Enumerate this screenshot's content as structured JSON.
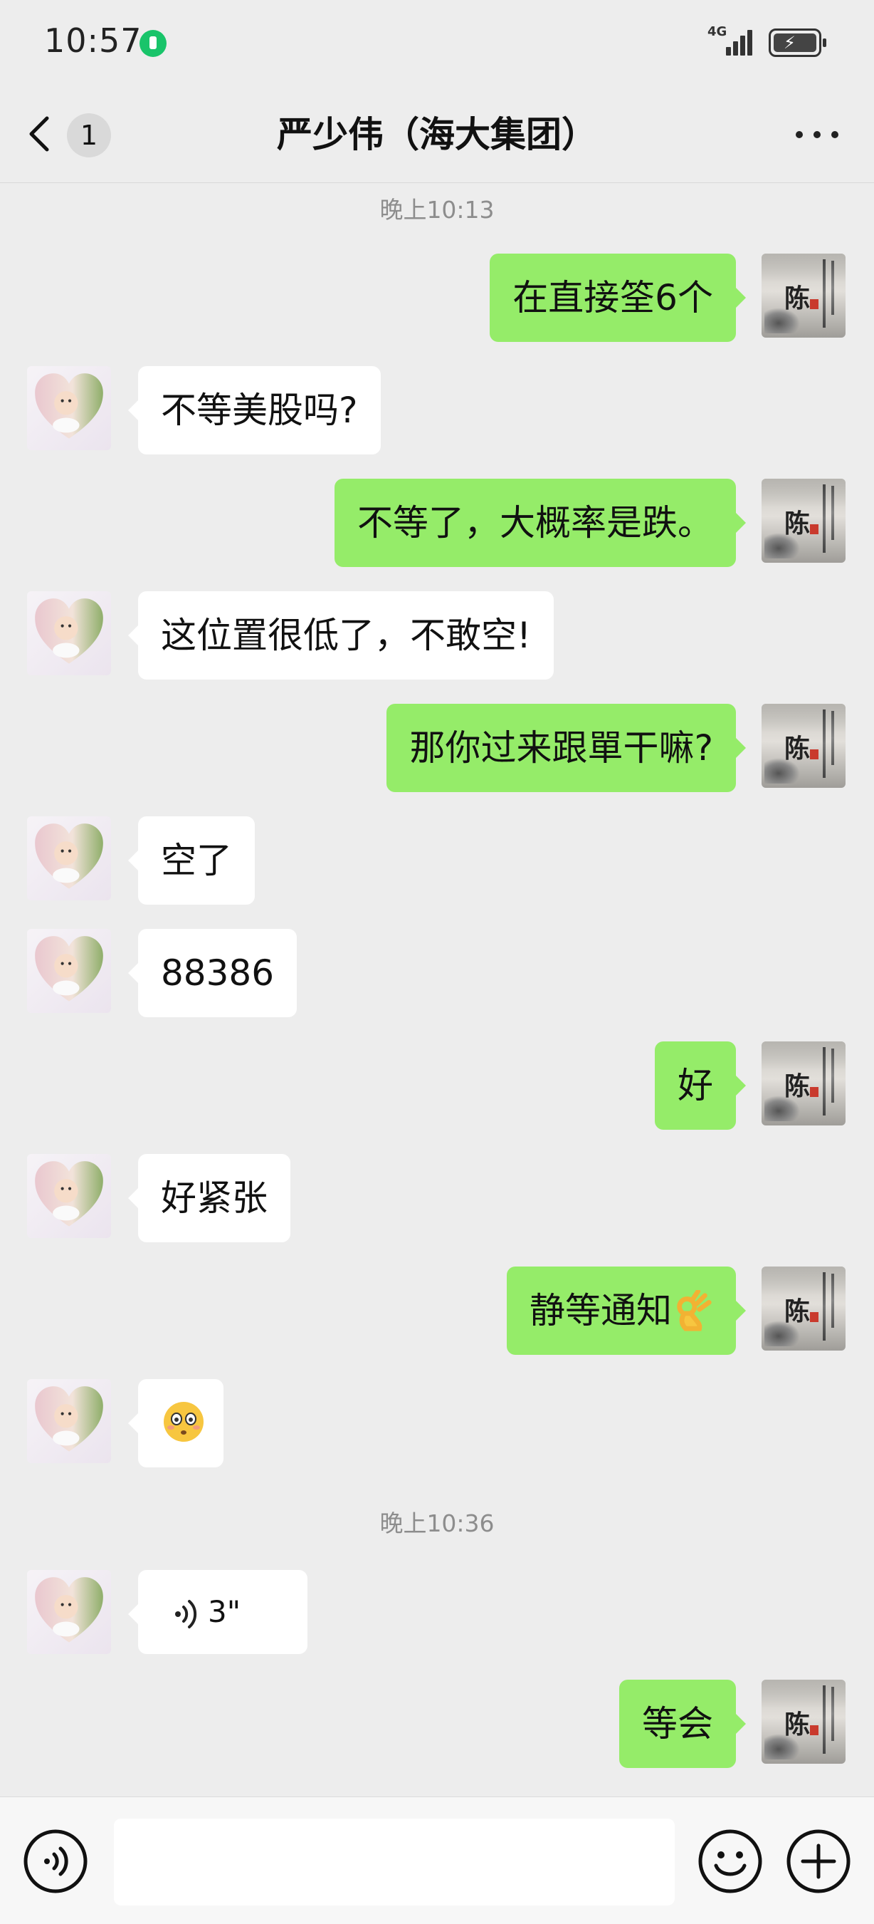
{
  "status_bar": {
    "time": "10:57",
    "network": "4G",
    "icons": [
      "wechat-activity-dot",
      "signal-icon",
      "battery-charging-icon"
    ]
  },
  "nav": {
    "back_icon": "chevron-left-icon",
    "unread_count": "1",
    "title": "严少伟（海大集团）",
    "more_icon": "more-dots-icon"
  },
  "chat": {
    "timestamps": [
      "晚上10:13",
      "晚上10:36"
    ],
    "messages": [
      {
        "side": "right",
        "type": "text",
        "text": "在直接筌6个"
      },
      {
        "side": "left",
        "type": "text",
        "text": "不等美股吗?"
      },
      {
        "side": "right",
        "type": "text",
        "text": "不等了，大概率是跌。"
      },
      {
        "side": "left",
        "type": "text",
        "text": "这位置很低了，不敢空!"
      },
      {
        "side": "right",
        "type": "text",
        "text": "那你过来跟單干嘛?"
      },
      {
        "side": "left",
        "type": "text",
        "text": "空了"
      },
      {
        "side": "left",
        "type": "text",
        "text": "88386"
      },
      {
        "side": "right",
        "type": "text",
        "text": "好"
      },
      {
        "side": "left",
        "type": "text",
        "text": "好紧张"
      },
      {
        "side": "right",
        "type": "text",
        "text": "静等通知",
        "emoji": "ok-hand-emoji"
      },
      {
        "side": "left",
        "type": "emoji",
        "emoji": "flushed-face-emoji"
      },
      {
        "side": "left",
        "type": "voice",
        "duration": "3\""
      },
      {
        "side": "right",
        "type": "text",
        "text": "等会"
      }
    ]
  },
  "avatars": {
    "left": "heart-photo-avatar",
    "right": "ink-painting-avatar"
  },
  "toolbar": {
    "voice_icon": "voice-input-icon",
    "input_value": "",
    "emoji_icon": "emoji-smile-icon",
    "plus_icon": "plus-circle-icon"
  },
  "colors": {
    "background": "#ededed",
    "bubble_self": "#95ec69",
    "bubble_other": "#ffffff",
    "timestamp": "#8d8d8d"
  }
}
